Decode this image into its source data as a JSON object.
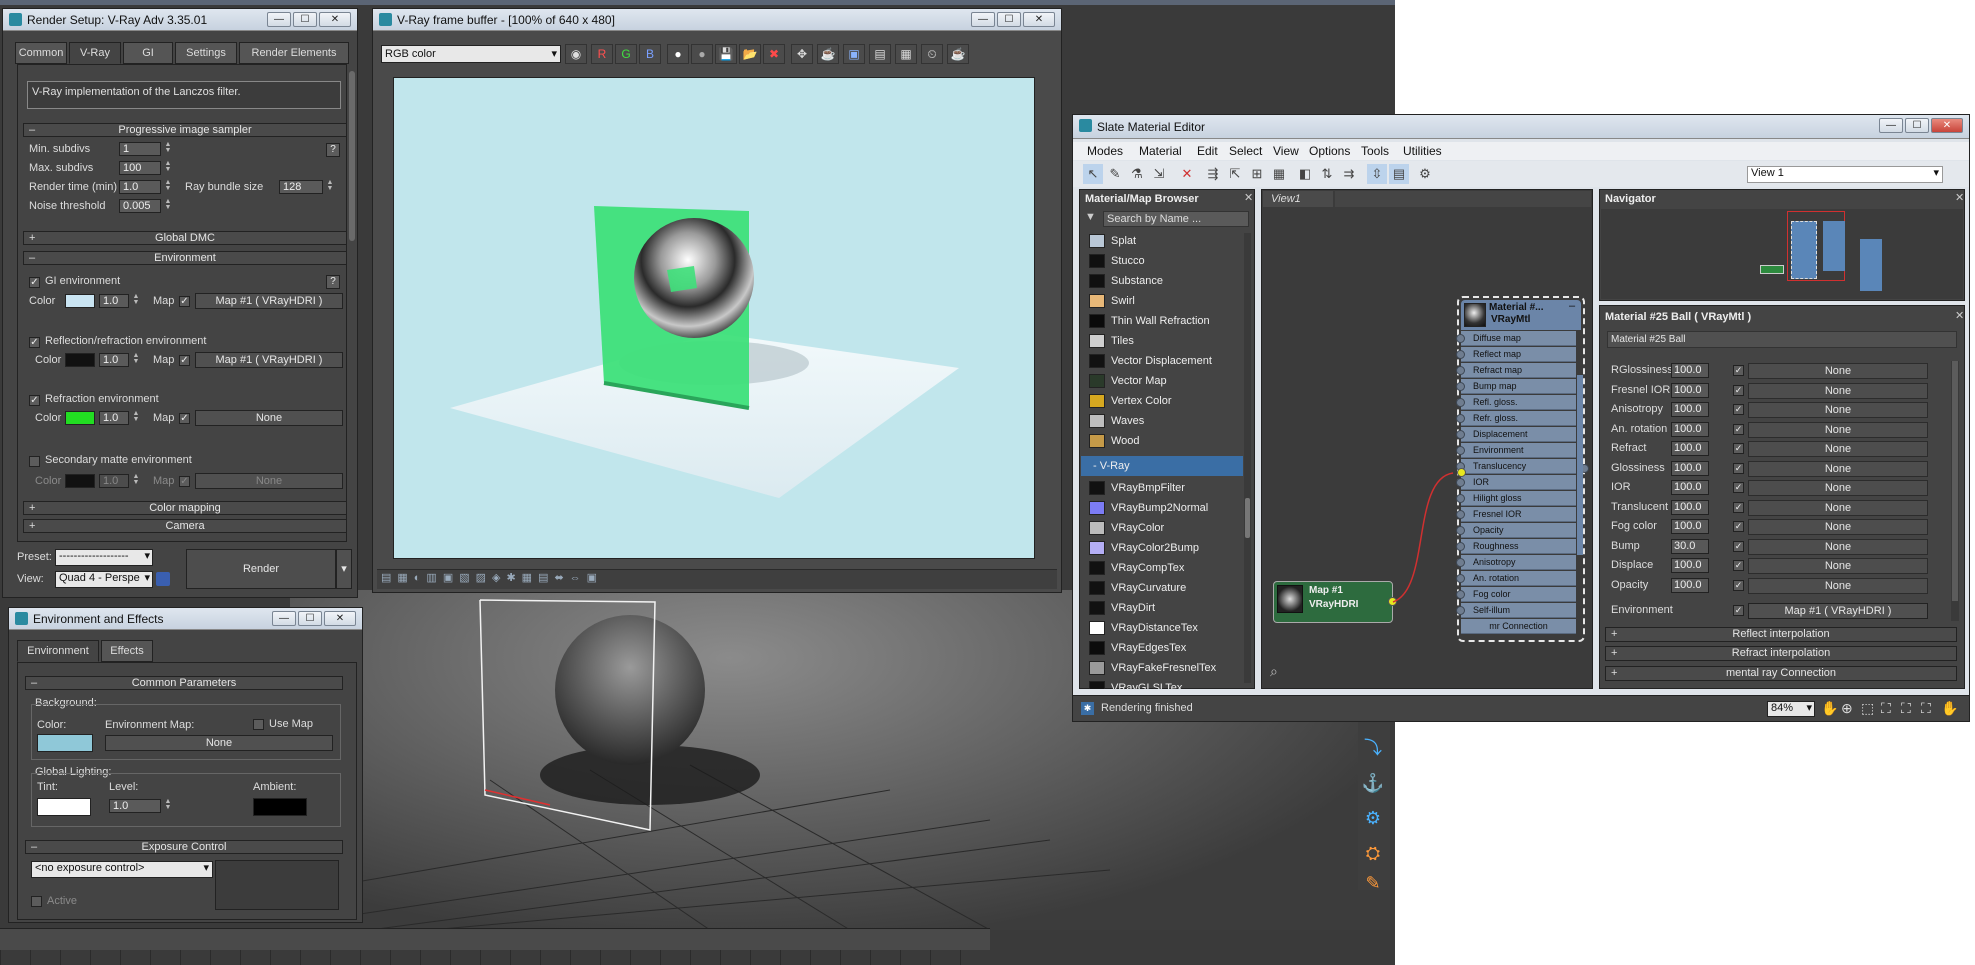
{
  "render_setup": {
    "title": "Render Setup: V-Ray Adv 3.35.01",
    "tabs": [
      "Common",
      "V-Ray",
      "GI",
      "Settings",
      "Render Elements"
    ],
    "filter_description": "V-Ray implementation of the Lanczos filter.",
    "progressive": {
      "header": "Progressive image sampler",
      "min_subdivs_label": "Min. subdivs",
      "min_subdivs": "1",
      "max_subdivs_label": "Max. subdivs",
      "max_subdivs": "100",
      "render_time_label": "Render time (min)",
      "render_time": "1.0",
      "ray_bundle_label": "Ray bundle size",
      "ray_bundle": "128",
      "noise_label": "Noise threshold",
      "noise": "0.005",
      "help": "?"
    },
    "global_dmc": "Global DMC",
    "environment": {
      "header": "Environment",
      "gi_label": "GI environment",
      "color_label": "Color",
      "map_label": "Map",
      "gi_mult": "1.0",
      "gi_map": "Map #1  ( VRayHDRI )",
      "gi_color": "#c9e4f2",
      "refl_label": "Reflection/refraction environment",
      "refl_mult": "1.0",
      "refl_map": "Map #1  ( VRayHDRI )",
      "refl_color": "#111111",
      "refr_label": "Refraction environment",
      "refr_mult": "1.0",
      "refr_map": "None",
      "refr_color": "#22dd22",
      "sec_label": "Secondary matte environment",
      "sec_mult": "1.0",
      "sec_map": "None",
      "sec_color": "#111111"
    },
    "color_mapping": "Color mapping",
    "camera": "Camera",
    "preset_label": "Preset:",
    "preset_value": "-------------------",
    "view_label": "View:",
    "view_value": "Quad 4 - Perspe",
    "render_button": "Render"
  },
  "env_effects": {
    "title": "Environment and Effects",
    "tabs": [
      "Environment",
      "Effects"
    ],
    "common_header": "Common Parameters",
    "background_label": "Background:",
    "color_label": "Color:",
    "env_map_label": "Environment Map:",
    "use_map_label": "Use Map",
    "env_map_value": "None",
    "bg_color": "#8fc8d8",
    "global_lighting_label": "Global Lighting:",
    "tint_label": "Tint:",
    "level_label": "Level:",
    "level_value": "1.0",
    "ambient_label": "Ambient:",
    "exposure_header": "Exposure Control",
    "exposure_value": "<no exposure control>",
    "active_label": "Active"
  },
  "vfb": {
    "title": "V-Ray frame buffer - [100% of 640 x 480]",
    "channel": "RGB color",
    "rgb_buttons": [
      "R",
      "G",
      "B"
    ],
    "sky_color": "#c1e6ec"
  },
  "sme": {
    "title": "Slate Material Editor",
    "menu": [
      "Modes",
      "Material",
      "Edit",
      "Select",
      "View",
      "Options",
      "Tools",
      "Utilities"
    ],
    "view_select": "View 1",
    "browser_title": "Material/Map Browser",
    "search_placeholder": "Search by Name ...",
    "maps": [
      {
        "name": "Splat",
        "color": "#b9c7d6"
      },
      {
        "name": "Stucco",
        "color": "#101010"
      },
      {
        "name": "Substance",
        "color": "#101010"
      },
      {
        "name": "Swirl",
        "color": "#e8b878"
      },
      {
        "name": "Thin Wall Refraction",
        "color": "#0a0a0a"
      },
      {
        "name": "Tiles",
        "color": "#cfcfcf"
      },
      {
        "name": "Vector Displacement",
        "color": "#111111"
      },
      {
        "name": "Vector Map",
        "color": "#2a3a2a"
      },
      {
        "name": "Vertex Color",
        "color": "#d6a820"
      },
      {
        "name": "Waves",
        "color": "#bdbdbd"
      },
      {
        "name": "Wood",
        "color": "#c59a48"
      }
    ],
    "vray_group": "- V-Ray",
    "vray_maps": [
      {
        "name": "VRayBmpFilter",
        "color": "#111111"
      },
      {
        "name": "VRayBump2Normal",
        "color": "#7c7cf5"
      },
      {
        "name": "VRayColor",
        "color": "#bcbcbc"
      },
      {
        "name": "VRayColor2Bump",
        "color": "#b4aef5"
      },
      {
        "name": "VRayCompTex",
        "color": "#111111"
      },
      {
        "name": "VRayCurvature",
        "color": "#111111"
      },
      {
        "name": "VRayDirt",
        "color": "#111111"
      },
      {
        "name": "VRayDistanceTex",
        "color": "#ffffff"
      },
      {
        "name": "VRayEdgesTex",
        "color": "#0c0c0c"
      },
      {
        "name": "VRayFakeFresnelTex",
        "color": "#9a9a9a"
      },
      {
        "name": "VRayGLSLTex",
        "color": "#111111"
      }
    ],
    "view_tab": "View1",
    "node_material_title": "Material #...",
    "node_material_type": "VRayMtl",
    "slots": [
      "Diffuse map",
      "Reflect map",
      "Refract map",
      "Bump map",
      "Refl. gloss.",
      "Refr. gloss.",
      "Displacement",
      "Environment",
      "Translucency",
      "IOR",
      "Hilight gloss",
      "Fresnel IOR",
      "Opacity",
      "Roughness",
      "Anisotropy",
      "An. rotation",
      "Fog color",
      "Self-illum",
      "mr Connection"
    ],
    "node_map_title": "Map #1",
    "node_map_type": "VRayHDRI",
    "navigator_title": "Navigator",
    "prop_title": "Material #25 Ball  ( VRayMtl )",
    "prop_name": "Material #25 Ball",
    "params": [
      {
        "label": "RGlossiness",
        "value": "100.0",
        "map": "None"
      },
      {
        "label": "Fresnel IOR",
        "value": "100.0",
        "map": "None"
      },
      {
        "label": "Anisotropy",
        "value": "100.0",
        "map": "None"
      },
      {
        "label": "An. rotation",
        "value": "100.0",
        "map": "None"
      },
      {
        "label": "Refract",
        "value": "100.0",
        "map": "None"
      },
      {
        "label": "Glossiness",
        "value": "100.0",
        "map": "None"
      },
      {
        "label": "IOR",
        "value": "100.0",
        "map": "None"
      },
      {
        "label": "Translucent",
        "value": "100.0",
        "map": "None"
      },
      {
        "label": "Fog color",
        "value": "100.0",
        "map": "None"
      },
      {
        "label": "Bump",
        "value": "30.0",
        "map": "None"
      },
      {
        "label": "Displace",
        "value": "100.0",
        "map": "None"
      },
      {
        "label": "Opacity",
        "value": "100.0",
        "map": "None"
      }
    ],
    "env_label": "Environment",
    "env_map": "Map #1  ( VRayHDRI )",
    "rollouts": [
      "Reflect interpolation",
      "Refract interpolation",
      "mental ray Connection"
    ],
    "status": "Rendering finished",
    "zoom": "84%"
  },
  "colors": {
    "vray_blue": "#7a8ea8",
    "hdri_green": "#2d6b3e",
    "wire_red": "#d03030",
    "select_blue": "#3a6ea5"
  }
}
